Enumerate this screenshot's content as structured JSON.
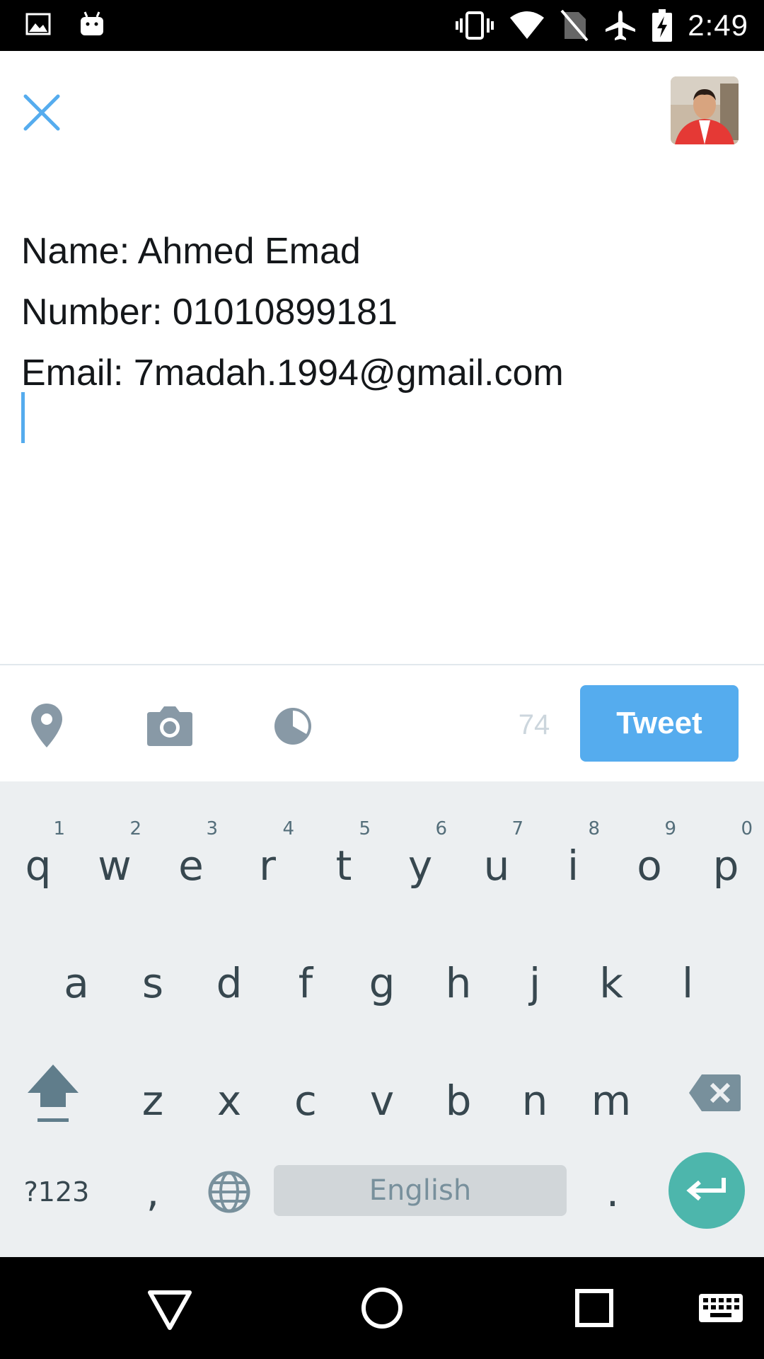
{
  "status_bar": {
    "time": "2:49",
    "icons": [
      "image-icon",
      "android-icon",
      "vibrate-icon",
      "wifi-icon",
      "no-sim-icon",
      "airplane-mode-icon",
      "battery-charging-icon"
    ]
  },
  "compose": {
    "lines": [
      "Name: Ahmed Emad",
      "Number: 01010899181",
      "Email: 7madah.1994@gmail.com"
    ],
    "close_icon": "close-icon",
    "avatar": "profile-avatar"
  },
  "toolbar": {
    "icons": [
      "location-pin-icon",
      "camera-icon",
      "poll-icon"
    ],
    "char_count": "74",
    "tweet_label": "Tweet"
  },
  "keyboard": {
    "row1": [
      {
        "letter": "q",
        "hint": "1"
      },
      {
        "letter": "w",
        "hint": "2"
      },
      {
        "letter": "e",
        "hint": "3"
      },
      {
        "letter": "r",
        "hint": "4"
      },
      {
        "letter": "t",
        "hint": "5"
      },
      {
        "letter": "y",
        "hint": "6"
      },
      {
        "letter": "u",
        "hint": "7"
      },
      {
        "letter": "i",
        "hint": "8"
      },
      {
        "letter": "o",
        "hint": "9"
      },
      {
        "letter": "p",
        "hint": "0"
      }
    ],
    "row2": [
      "a",
      "s",
      "d",
      "f",
      "g",
      "h",
      "j",
      "k",
      "l"
    ],
    "row3": [
      "z",
      "x",
      "c",
      "v",
      "b",
      "n",
      "m"
    ],
    "symbols_label": "?123",
    "comma": ",",
    "period": ".",
    "space_label": "English"
  },
  "colors": {
    "accent": "#55acee",
    "enter": "#4db6ac",
    "keyboard_bg": "#eceff1"
  }
}
